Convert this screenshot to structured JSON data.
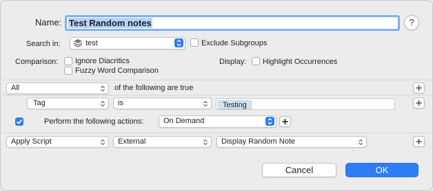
{
  "name": {
    "label": "Name:",
    "value": "Test Random notes"
  },
  "help_label": "?",
  "search_in": {
    "label": "Search in:",
    "value": "test",
    "exclude_label": "Exclude Subgroups"
  },
  "comparison": {
    "label": "Comparison:",
    "ignore_label": "Ignore Diacritics",
    "fuzzy_label": "Fuzzy Word Comparison"
  },
  "display": {
    "label": "Display:",
    "highlight_label": "Highlight Occurrences"
  },
  "match": {
    "value": "All",
    "suffix": "of the following are true"
  },
  "condition": {
    "field": "Tag",
    "operator": "is",
    "tag_value": "Testing"
  },
  "perform": {
    "label": "Perform the following actions:",
    "trigger": "On Demand",
    "checked": true
  },
  "action": {
    "type": "Apply Script",
    "source": "External",
    "script": "Display Random Note"
  },
  "buttons": {
    "cancel": "Cancel",
    "ok": "OK"
  },
  "colors": {
    "accent": "#2e7cf6",
    "background": "#ececec"
  }
}
